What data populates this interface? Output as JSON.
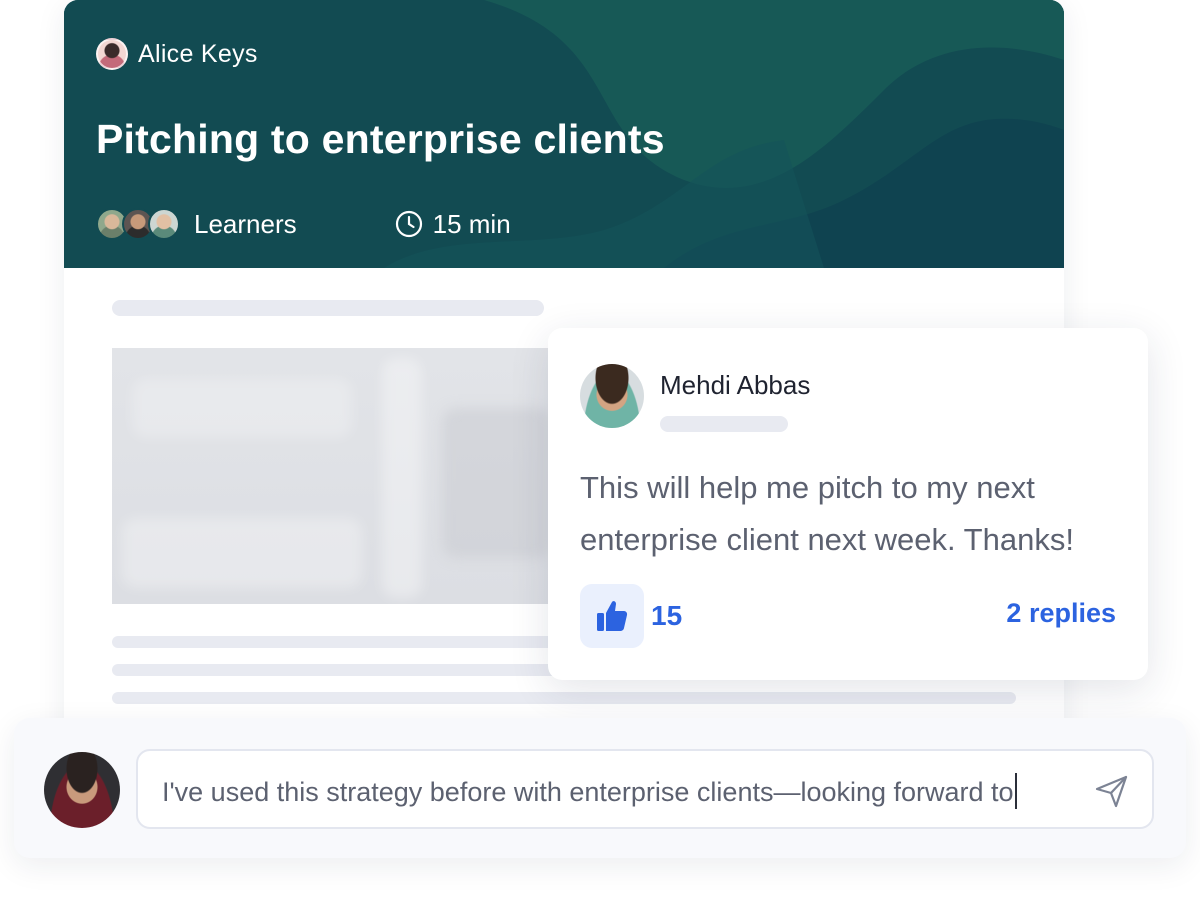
{
  "course": {
    "author_name": "Alice Keys",
    "title": "Pitching to enterprise clients",
    "learners_label": "Learners",
    "duration": "15 min"
  },
  "comment": {
    "author_name": "Mehdi Abbas",
    "text": "This will help me pitch to my next enterprise client next week. Thanks!",
    "likes": "15",
    "replies_label": "2 replies"
  },
  "reply": {
    "input_value": "I've used this strategy before with enterprise clients—looking forward to"
  },
  "icons": {
    "clock": "clock-icon",
    "like": "thumbs-up-icon",
    "send": "send-icon"
  },
  "colors": {
    "hero_bg": "#124b52",
    "accent": "#2c63e0",
    "like_bg": "#eaf0fd"
  }
}
